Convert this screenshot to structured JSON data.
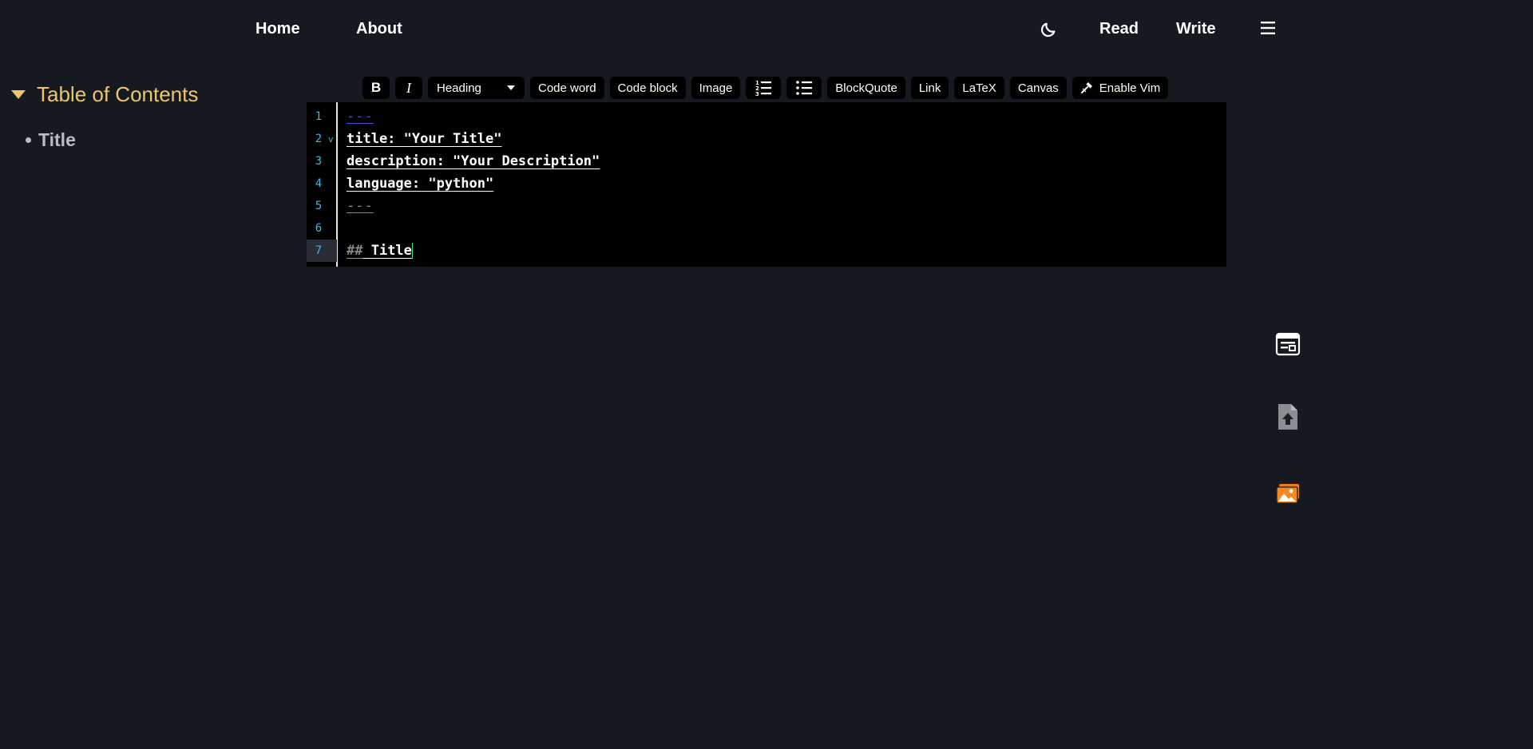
{
  "nav": {
    "home": "Home",
    "about": "About",
    "read": "Read",
    "write": "Write",
    "theme_icon": "moon-icon",
    "menu_icon": "hamburger-menu-icon"
  },
  "toc": {
    "title": "Table of Contents",
    "items": [
      {
        "label": "Title"
      }
    ]
  },
  "toolbar": {
    "bold": "B",
    "italic": "I",
    "heading": "Heading",
    "code_word": "Code word",
    "code_block": "Code block",
    "image": "Image",
    "ordered_list_icon": "ordered-list-icon",
    "unordered_list_icon": "unordered-list-icon",
    "blockquote": "BlockQuote",
    "link": "Link",
    "latex": "LaTeX",
    "canvas": "Canvas",
    "vim": "Enable Vim"
  },
  "editor": {
    "line_numbers": [
      "1",
      "2",
      "3",
      "4",
      "5",
      "6",
      "7"
    ],
    "active_line": 7,
    "fold_marker": "v",
    "lines": {
      "l1": "---",
      "l2": "title: \"Your Title\"",
      "l3": "description: \"Your Description\"",
      "l4": "language: \"python\"",
      "l5": "---",
      "l6": "",
      "l7_mark": "##",
      "l7_text": " Title"
    }
  },
  "side_icons": [
    "preview-layout-icon",
    "file-upload-icon",
    "image-gallery-icon"
  ],
  "colors": {
    "background": "#161a20",
    "toc_accent": "#ecc66e",
    "line_number": "#3fb8e6",
    "gallery_orange": "#f07a12"
  }
}
